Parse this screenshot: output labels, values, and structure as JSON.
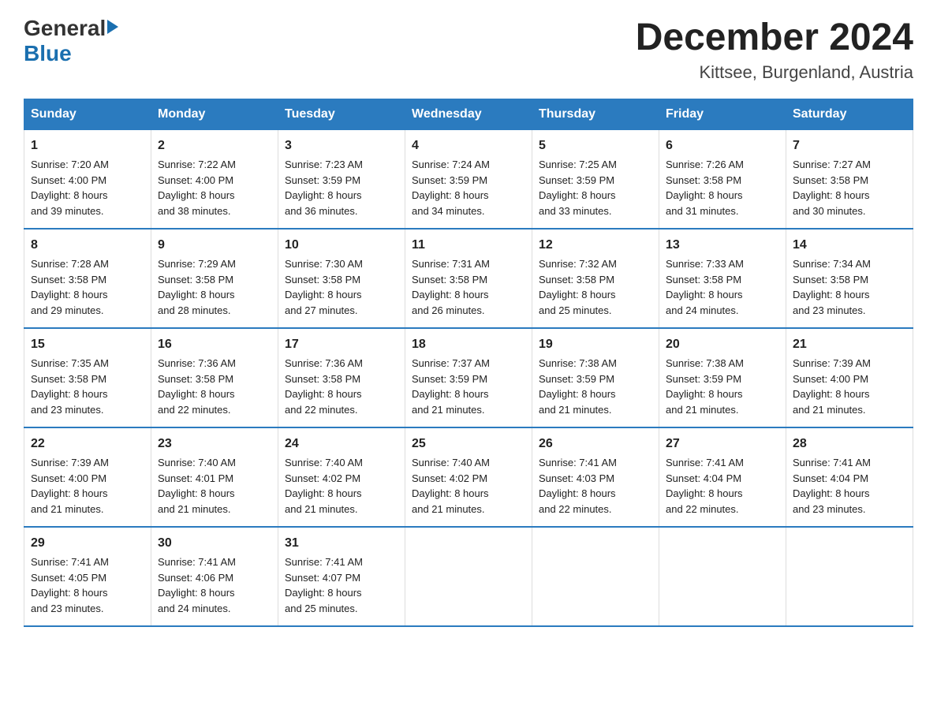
{
  "header": {
    "logo_general": "General",
    "logo_blue": "Blue",
    "title": "December 2024",
    "subtitle": "Kittsee, Burgenland, Austria"
  },
  "weekdays": [
    "Sunday",
    "Monday",
    "Tuesday",
    "Wednesday",
    "Thursday",
    "Friday",
    "Saturday"
  ],
  "weeks": [
    [
      {
        "day": "1",
        "sunrise": "7:20 AM",
        "sunset": "4:00 PM",
        "daylight": "8 hours and 39 minutes."
      },
      {
        "day": "2",
        "sunrise": "7:22 AM",
        "sunset": "4:00 PM",
        "daylight": "8 hours and 38 minutes."
      },
      {
        "day": "3",
        "sunrise": "7:23 AM",
        "sunset": "3:59 PM",
        "daylight": "8 hours and 36 minutes."
      },
      {
        "day": "4",
        "sunrise": "7:24 AM",
        "sunset": "3:59 PM",
        "daylight": "8 hours and 34 minutes."
      },
      {
        "day": "5",
        "sunrise": "7:25 AM",
        "sunset": "3:59 PM",
        "daylight": "8 hours and 33 minutes."
      },
      {
        "day": "6",
        "sunrise": "7:26 AM",
        "sunset": "3:58 PM",
        "daylight": "8 hours and 31 minutes."
      },
      {
        "day": "7",
        "sunrise": "7:27 AM",
        "sunset": "3:58 PM",
        "daylight": "8 hours and 30 minutes."
      }
    ],
    [
      {
        "day": "8",
        "sunrise": "7:28 AM",
        "sunset": "3:58 PM",
        "daylight": "8 hours and 29 minutes."
      },
      {
        "day": "9",
        "sunrise": "7:29 AM",
        "sunset": "3:58 PM",
        "daylight": "8 hours and 28 minutes."
      },
      {
        "day": "10",
        "sunrise": "7:30 AM",
        "sunset": "3:58 PM",
        "daylight": "8 hours and 27 minutes."
      },
      {
        "day": "11",
        "sunrise": "7:31 AM",
        "sunset": "3:58 PM",
        "daylight": "8 hours and 26 minutes."
      },
      {
        "day": "12",
        "sunrise": "7:32 AM",
        "sunset": "3:58 PM",
        "daylight": "8 hours and 25 minutes."
      },
      {
        "day": "13",
        "sunrise": "7:33 AM",
        "sunset": "3:58 PM",
        "daylight": "8 hours and 24 minutes."
      },
      {
        "day": "14",
        "sunrise": "7:34 AM",
        "sunset": "3:58 PM",
        "daylight": "8 hours and 23 minutes."
      }
    ],
    [
      {
        "day": "15",
        "sunrise": "7:35 AM",
        "sunset": "3:58 PM",
        "daylight": "8 hours and 23 minutes."
      },
      {
        "day": "16",
        "sunrise": "7:36 AM",
        "sunset": "3:58 PM",
        "daylight": "8 hours and 22 minutes."
      },
      {
        "day": "17",
        "sunrise": "7:36 AM",
        "sunset": "3:58 PM",
        "daylight": "8 hours and 22 minutes."
      },
      {
        "day": "18",
        "sunrise": "7:37 AM",
        "sunset": "3:59 PM",
        "daylight": "8 hours and 21 minutes."
      },
      {
        "day": "19",
        "sunrise": "7:38 AM",
        "sunset": "3:59 PM",
        "daylight": "8 hours and 21 minutes."
      },
      {
        "day": "20",
        "sunrise": "7:38 AM",
        "sunset": "3:59 PM",
        "daylight": "8 hours and 21 minutes."
      },
      {
        "day": "21",
        "sunrise": "7:39 AM",
        "sunset": "4:00 PM",
        "daylight": "8 hours and 21 minutes."
      }
    ],
    [
      {
        "day": "22",
        "sunrise": "7:39 AM",
        "sunset": "4:00 PM",
        "daylight": "8 hours and 21 minutes."
      },
      {
        "day": "23",
        "sunrise": "7:40 AM",
        "sunset": "4:01 PM",
        "daylight": "8 hours and 21 minutes."
      },
      {
        "day": "24",
        "sunrise": "7:40 AM",
        "sunset": "4:02 PM",
        "daylight": "8 hours and 21 minutes."
      },
      {
        "day": "25",
        "sunrise": "7:40 AM",
        "sunset": "4:02 PM",
        "daylight": "8 hours and 21 minutes."
      },
      {
        "day": "26",
        "sunrise": "7:41 AM",
        "sunset": "4:03 PM",
        "daylight": "8 hours and 22 minutes."
      },
      {
        "day": "27",
        "sunrise": "7:41 AM",
        "sunset": "4:04 PM",
        "daylight": "8 hours and 22 minutes."
      },
      {
        "day": "28",
        "sunrise": "7:41 AM",
        "sunset": "4:04 PM",
        "daylight": "8 hours and 23 minutes."
      }
    ],
    [
      {
        "day": "29",
        "sunrise": "7:41 AM",
        "sunset": "4:05 PM",
        "daylight": "8 hours and 23 minutes."
      },
      {
        "day": "30",
        "sunrise": "7:41 AM",
        "sunset": "4:06 PM",
        "daylight": "8 hours and 24 minutes."
      },
      {
        "day": "31",
        "sunrise": "7:41 AM",
        "sunset": "4:07 PM",
        "daylight": "8 hours and 25 minutes."
      },
      null,
      null,
      null,
      null
    ]
  ],
  "labels": {
    "sunrise": "Sunrise:",
    "sunset": "Sunset:",
    "daylight": "Daylight:"
  }
}
